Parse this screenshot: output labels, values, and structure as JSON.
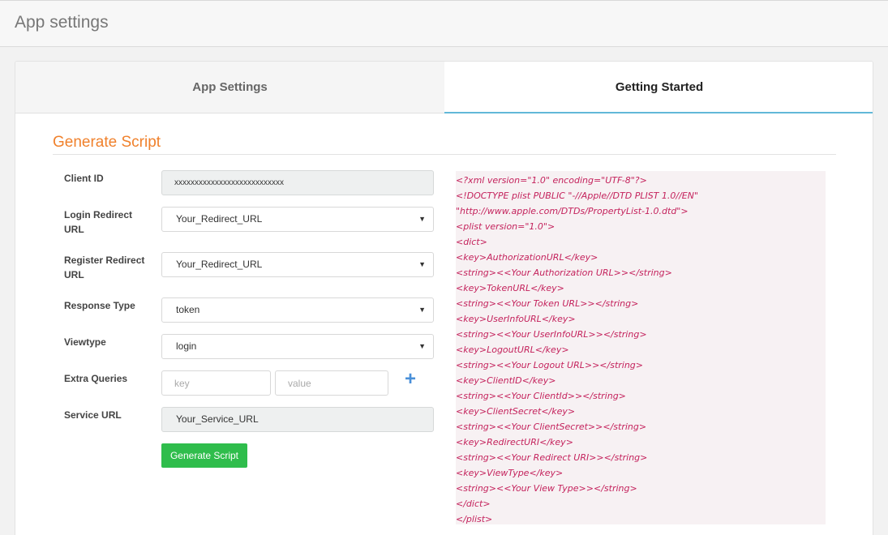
{
  "header": {
    "title": "App settings"
  },
  "tabs": [
    {
      "label": "App Settings",
      "active": false
    },
    {
      "label": "Getting Started",
      "active": true
    }
  ],
  "section": {
    "title": "Generate Script"
  },
  "form": {
    "client_id": {
      "label": "Client ID",
      "value": "xxxxxxxxxxxxxxxxxxxxxxxxxxx"
    },
    "login_redirect": {
      "label": "Login Redirect URL",
      "value": "Your_Redirect_URL"
    },
    "register_redirect": {
      "label": "Register Redirect URL",
      "value": "Your_Redirect_URL"
    },
    "response_type": {
      "label": "Response Type",
      "value": "token"
    },
    "viewtype": {
      "label": "Viewtype",
      "value": "login"
    },
    "extra_queries": {
      "label": "Extra Queries",
      "key_placeholder": "key",
      "value_placeholder": "value"
    },
    "service_url": {
      "label": "Service URL",
      "value": "Your_Service_URL"
    },
    "generate_label": "Generate Script"
  },
  "icons": {
    "select_arrow": "caret-down-icon",
    "add": "plus-icon"
  },
  "colors": {
    "section_title": "#f0812c",
    "button": "#2fbd4c",
    "code_text": "#c4225c",
    "code_bg": "#f7f1f3",
    "tab_underline": "#62b8d8",
    "plus": "#4a90d9"
  },
  "code_lines": [
    "<?xml version=\"1.0\" encoding=\"UTF-8\"?>",
    "<!DOCTYPE plist PUBLIC \"-//Apple//DTD PLIST 1.0//EN\"",
    "\"http://www.apple.com/DTDs/PropertyList-1.0.dtd\">",
    "<plist version=\"1.0\">",
    "<dict>",
    "<key>AuthorizationURL</key>",
    "<string><<Your Authorization URL>></string>",
    "<key>TokenURL</key>",
    "<string><<Your Token URL>></string>",
    "<key>UserInfoURL</key>",
    "<string><<Your UserInfoURL>></string>",
    "<key>LogoutURL</key>",
    "<string><<Your Logout URL>></string>",
    "<key>ClientID</key>",
    "<string><<Your ClientId>></string>",
    "<key>ClientSecret</key>",
    "<string><<Your ClientSecret>></string>",
    "<key>RedirectURI</key>",
    "<string><<Your Redirect URI>></string>",
    "<key>ViewType</key>",
    "<string><<Your View Type>></string>",
    "</dict>",
    "</plist>"
  ]
}
